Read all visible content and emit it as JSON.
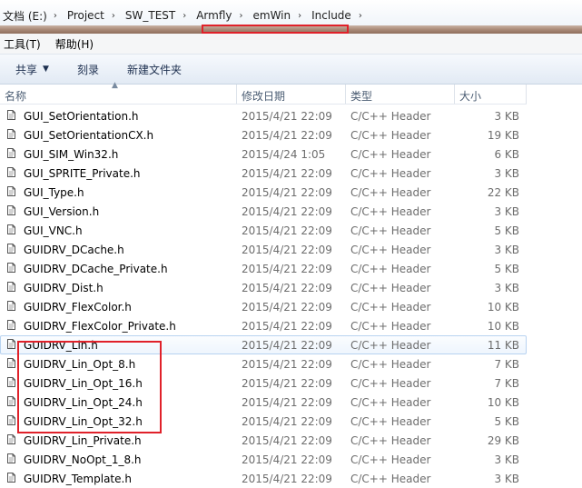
{
  "address": {
    "crumbs": [
      "文档 (E:)",
      "Project",
      "SW_TEST",
      "Armfly",
      "emWin",
      "Include"
    ],
    "separator": "›"
  },
  "menubar": {
    "items": [
      "工具(T)",
      "帮助(H)"
    ]
  },
  "toolbar": {
    "share": "共享",
    "share_caret": "▼",
    "burn": "刻录",
    "new_folder": "新建文件夹"
  },
  "columns": {
    "name": "名称",
    "date": "修改日期",
    "type": "类型",
    "size": "大小",
    "sort_indicator": "▲"
  },
  "files": [
    {
      "name": "GUI_SetOrientation.h",
      "date": "2015/4/21 22:09",
      "type": "C/C++ Header",
      "size": "3 KB"
    },
    {
      "name": "GUI_SetOrientationCX.h",
      "date": "2015/4/21 22:09",
      "type": "C/C++ Header",
      "size": "19 KB"
    },
    {
      "name": "GUI_SIM_Win32.h",
      "date": "2015/4/24 1:05",
      "type": "C/C++ Header",
      "size": "6 KB"
    },
    {
      "name": "GUI_SPRITE_Private.h",
      "date": "2015/4/21 22:09",
      "type": "C/C++ Header",
      "size": "3 KB"
    },
    {
      "name": "GUI_Type.h",
      "date": "2015/4/21 22:09",
      "type": "C/C++ Header",
      "size": "22 KB"
    },
    {
      "name": "GUI_Version.h",
      "date": "2015/4/21 22:09",
      "type": "C/C++ Header",
      "size": "3 KB"
    },
    {
      "name": "GUI_VNC.h",
      "date": "2015/4/21 22:09",
      "type": "C/C++ Header",
      "size": "5 KB"
    },
    {
      "name": "GUIDRV_DCache.h",
      "date": "2015/4/21 22:09",
      "type": "C/C++ Header",
      "size": "3 KB"
    },
    {
      "name": "GUIDRV_DCache_Private.h",
      "date": "2015/4/21 22:09",
      "type": "C/C++ Header",
      "size": "5 KB"
    },
    {
      "name": "GUIDRV_Dist.h",
      "date": "2015/4/21 22:09",
      "type": "C/C++ Header",
      "size": "3 KB"
    },
    {
      "name": "GUIDRV_FlexColor.h",
      "date": "2015/4/21 22:09",
      "type": "C/C++ Header",
      "size": "10 KB"
    },
    {
      "name": "GUIDRV_FlexColor_Private.h",
      "date": "2015/4/21 22:09",
      "type": "C/C++ Header",
      "size": "10 KB"
    },
    {
      "name": "GUIDRV_Lin.h",
      "date": "2015/4/21 22:09",
      "type": "C/C++ Header",
      "size": "11 KB",
      "highlighted": true
    },
    {
      "name": "GUIDRV_Lin_Opt_8.h",
      "date": "2015/4/21 22:09",
      "type": "C/C++ Header",
      "size": "7 KB"
    },
    {
      "name": "GUIDRV_Lin_Opt_16.h",
      "date": "2015/4/21 22:09",
      "type": "C/C++ Header",
      "size": "7 KB"
    },
    {
      "name": "GUIDRV_Lin_Opt_24.h",
      "date": "2015/4/21 22:09",
      "type": "C/C++ Header",
      "size": "10 KB"
    },
    {
      "name": "GUIDRV_Lin_Opt_32.h",
      "date": "2015/4/21 22:09",
      "type": "C/C++ Header",
      "size": "5 KB"
    },
    {
      "name": "GUIDRV_Lin_Private.h",
      "date": "2015/4/21 22:09",
      "type": "C/C++ Header",
      "size": "29 KB"
    },
    {
      "name": "GUIDRV_NoOpt_1_8.h",
      "date": "2015/4/21 22:09",
      "type": "C/C++ Header",
      "size": "3 KB"
    },
    {
      "name": "GUIDRV_Template.h",
      "date": "2015/4/21 22:09",
      "type": "C/C++ Header",
      "size": "3 KB"
    }
  ],
  "colors": {
    "annotation_red": "#e0212a",
    "hover_border": "#b8d3f0"
  },
  "icons": {
    "file": "file-icon",
    "separator": "chevron-right-icon",
    "sort": "sort-ascending-icon"
  }
}
